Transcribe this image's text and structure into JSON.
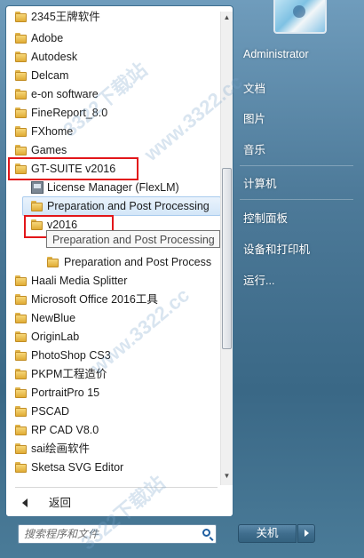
{
  "start_menu": {
    "programs": [
      {
        "label": "2345王牌软件"
      },
      {
        "label": "Adobe"
      },
      {
        "label": "Autodesk"
      },
      {
        "label": "Delcam"
      },
      {
        "label": "e-on software"
      },
      {
        "label": "FineReport_8.0"
      },
      {
        "label": "FXhome"
      },
      {
        "label": "Games"
      },
      {
        "label": "GT-SUITE v2016"
      },
      {
        "label": "License Manager (FlexLM)"
      },
      {
        "label": "Preparation and Post Processing"
      },
      {
        "label": "v2016"
      },
      {
        "label": "Preparation and Post Process"
      },
      {
        "label": "Haali Media Splitter"
      },
      {
        "label": "Microsoft Office 2016工具"
      },
      {
        "label": "NewBlue"
      },
      {
        "label": "OriginLab"
      },
      {
        "label": "PhotoShop CS3"
      },
      {
        "label": "PKPM工程造价"
      },
      {
        "label": "PortraitPro 15"
      },
      {
        "label": "PSCAD"
      },
      {
        "label": "RP CAD V8.0"
      },
      {
        "label": "sai绘画软件"
      },
      {
        "label": "Sketsa SVG Editor"
      }
    ],
    "tooltip": "Preparation and Post Processing",
    "back_label": "返回",
    "search_placeholder": "搜索程序和文件",
    "right_links": {
      "user": "Administrator",
      "documents": "文档",
      "pictures": "图片",
      "music": "音乐",
      "computer": "计算机",
      "control_panel": "控制面板",
      "devices_printers": "设备和打印机",
      "run": "运行..."
    },
    "shutdown_label": "关机",
    "watermarks": [
      "3322下载站",
      "www.3322.cc"
    ],
    "annotation_color": "#e2161a",
    "highlight_color": "#d3e6f8"
  }
}
